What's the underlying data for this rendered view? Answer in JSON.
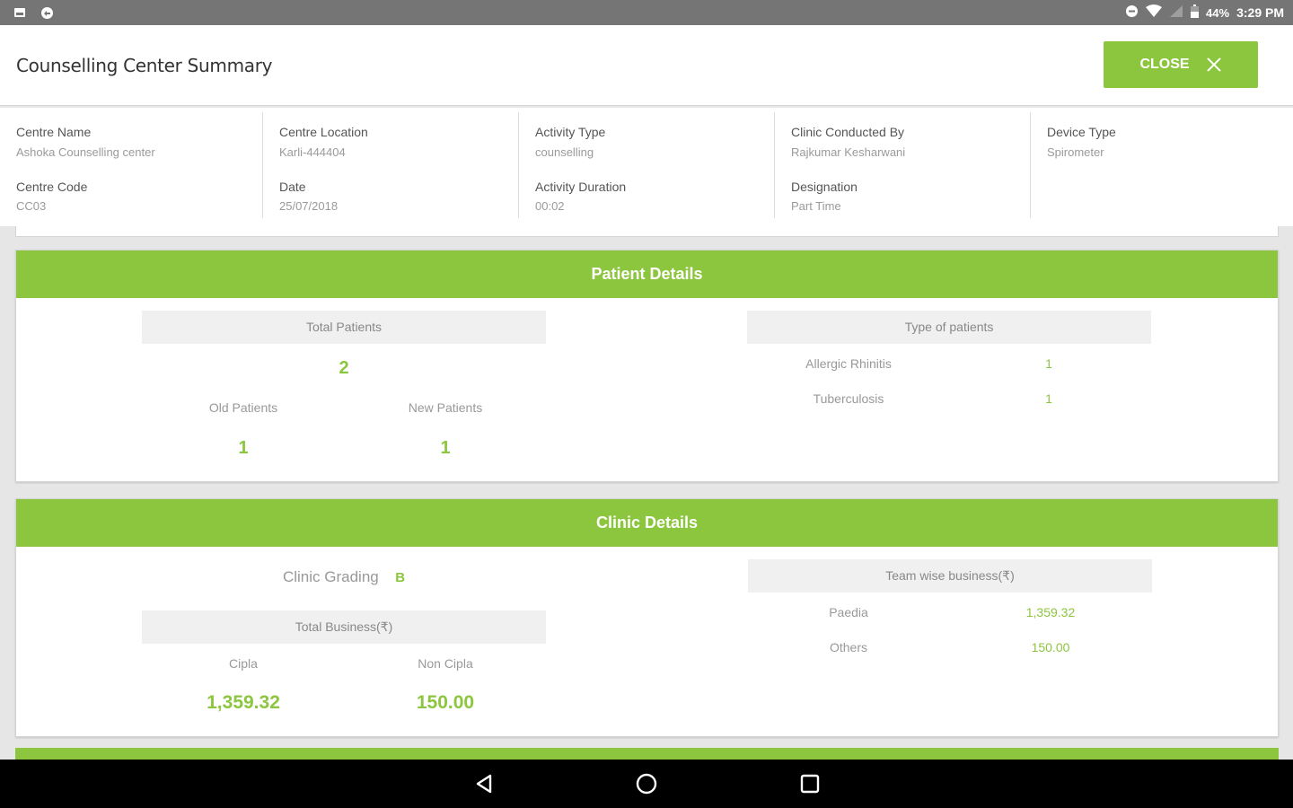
{
  "status_bar": {
    "battery": "44%",
    "time": "3:29 PM"
  },
  "header": {
    "title": "Counselling Center Summary",
    "close_label": "CLOSE"
  },
  "info": {
    "centre_name_label": "Centre Name",
    "centre_name": "Ashoka Counselling center",
    "centre_code_label": "Centre Code",
    "centre_code": "CC03",
    "centre_location_label": "Centre Location",
    "centre_location": "Karli-444404",
    "date_label": "Date",
    "date": "25/07/2018",
    "activity_type_label": "Activity Type",
    "activity_type": "counselling",
    "activity_duration_label": "Activity Duration",
    "activity_duration": "00:02",
    "conducted_by_label": "Clinic Conducted By",
    "conducted_by": "Rajkumar Kesharwani",
    "designation_label": "Designation",
    "designation": "Part Time",
    "device_type_label": "Device Type",
    "device_type": "Spirometer"
  },
  "patient_details": {
    "title": "Patient Details",
    "total_label": "Total Patients",
    "total": "2",
    "old_label": "Old Patients",
    "old": "1",
    "new_label": "New Patients",
    "new": "1",
    "types_label": "Type of patients",
    "types": [
      {
        "name": "Allergic Rhinitis",
        "count": "1"
      },
      {
        "name": "Tuberculosis",
        "count": "1"
      }
    ]
  },
  "clinic_details": {
    "title": "Clinic Details",
    "grading_label": "Clinic Grading",
    "grading": "B",
    "total_business_label": "Total Business(₹)",
    "cipla_label": "Cipla",
    "cipla": "1,359.32",
    "non_cipla_label": "Non Cipla",
    "non_cipla": "150.00",
    "team_label": "Team wise business(₹)",
    "teams": [
      {
        "name": "Paedia",
        "value": "1,359.32"
      },
      {
        "name": "Others",
        "value": "150.00"
      }
    ]
  },
  "colors": {
    "accent": "#8cc63e",
    "status_bar": "#757575",
    "nav_bar": "#000000"
  }
}
